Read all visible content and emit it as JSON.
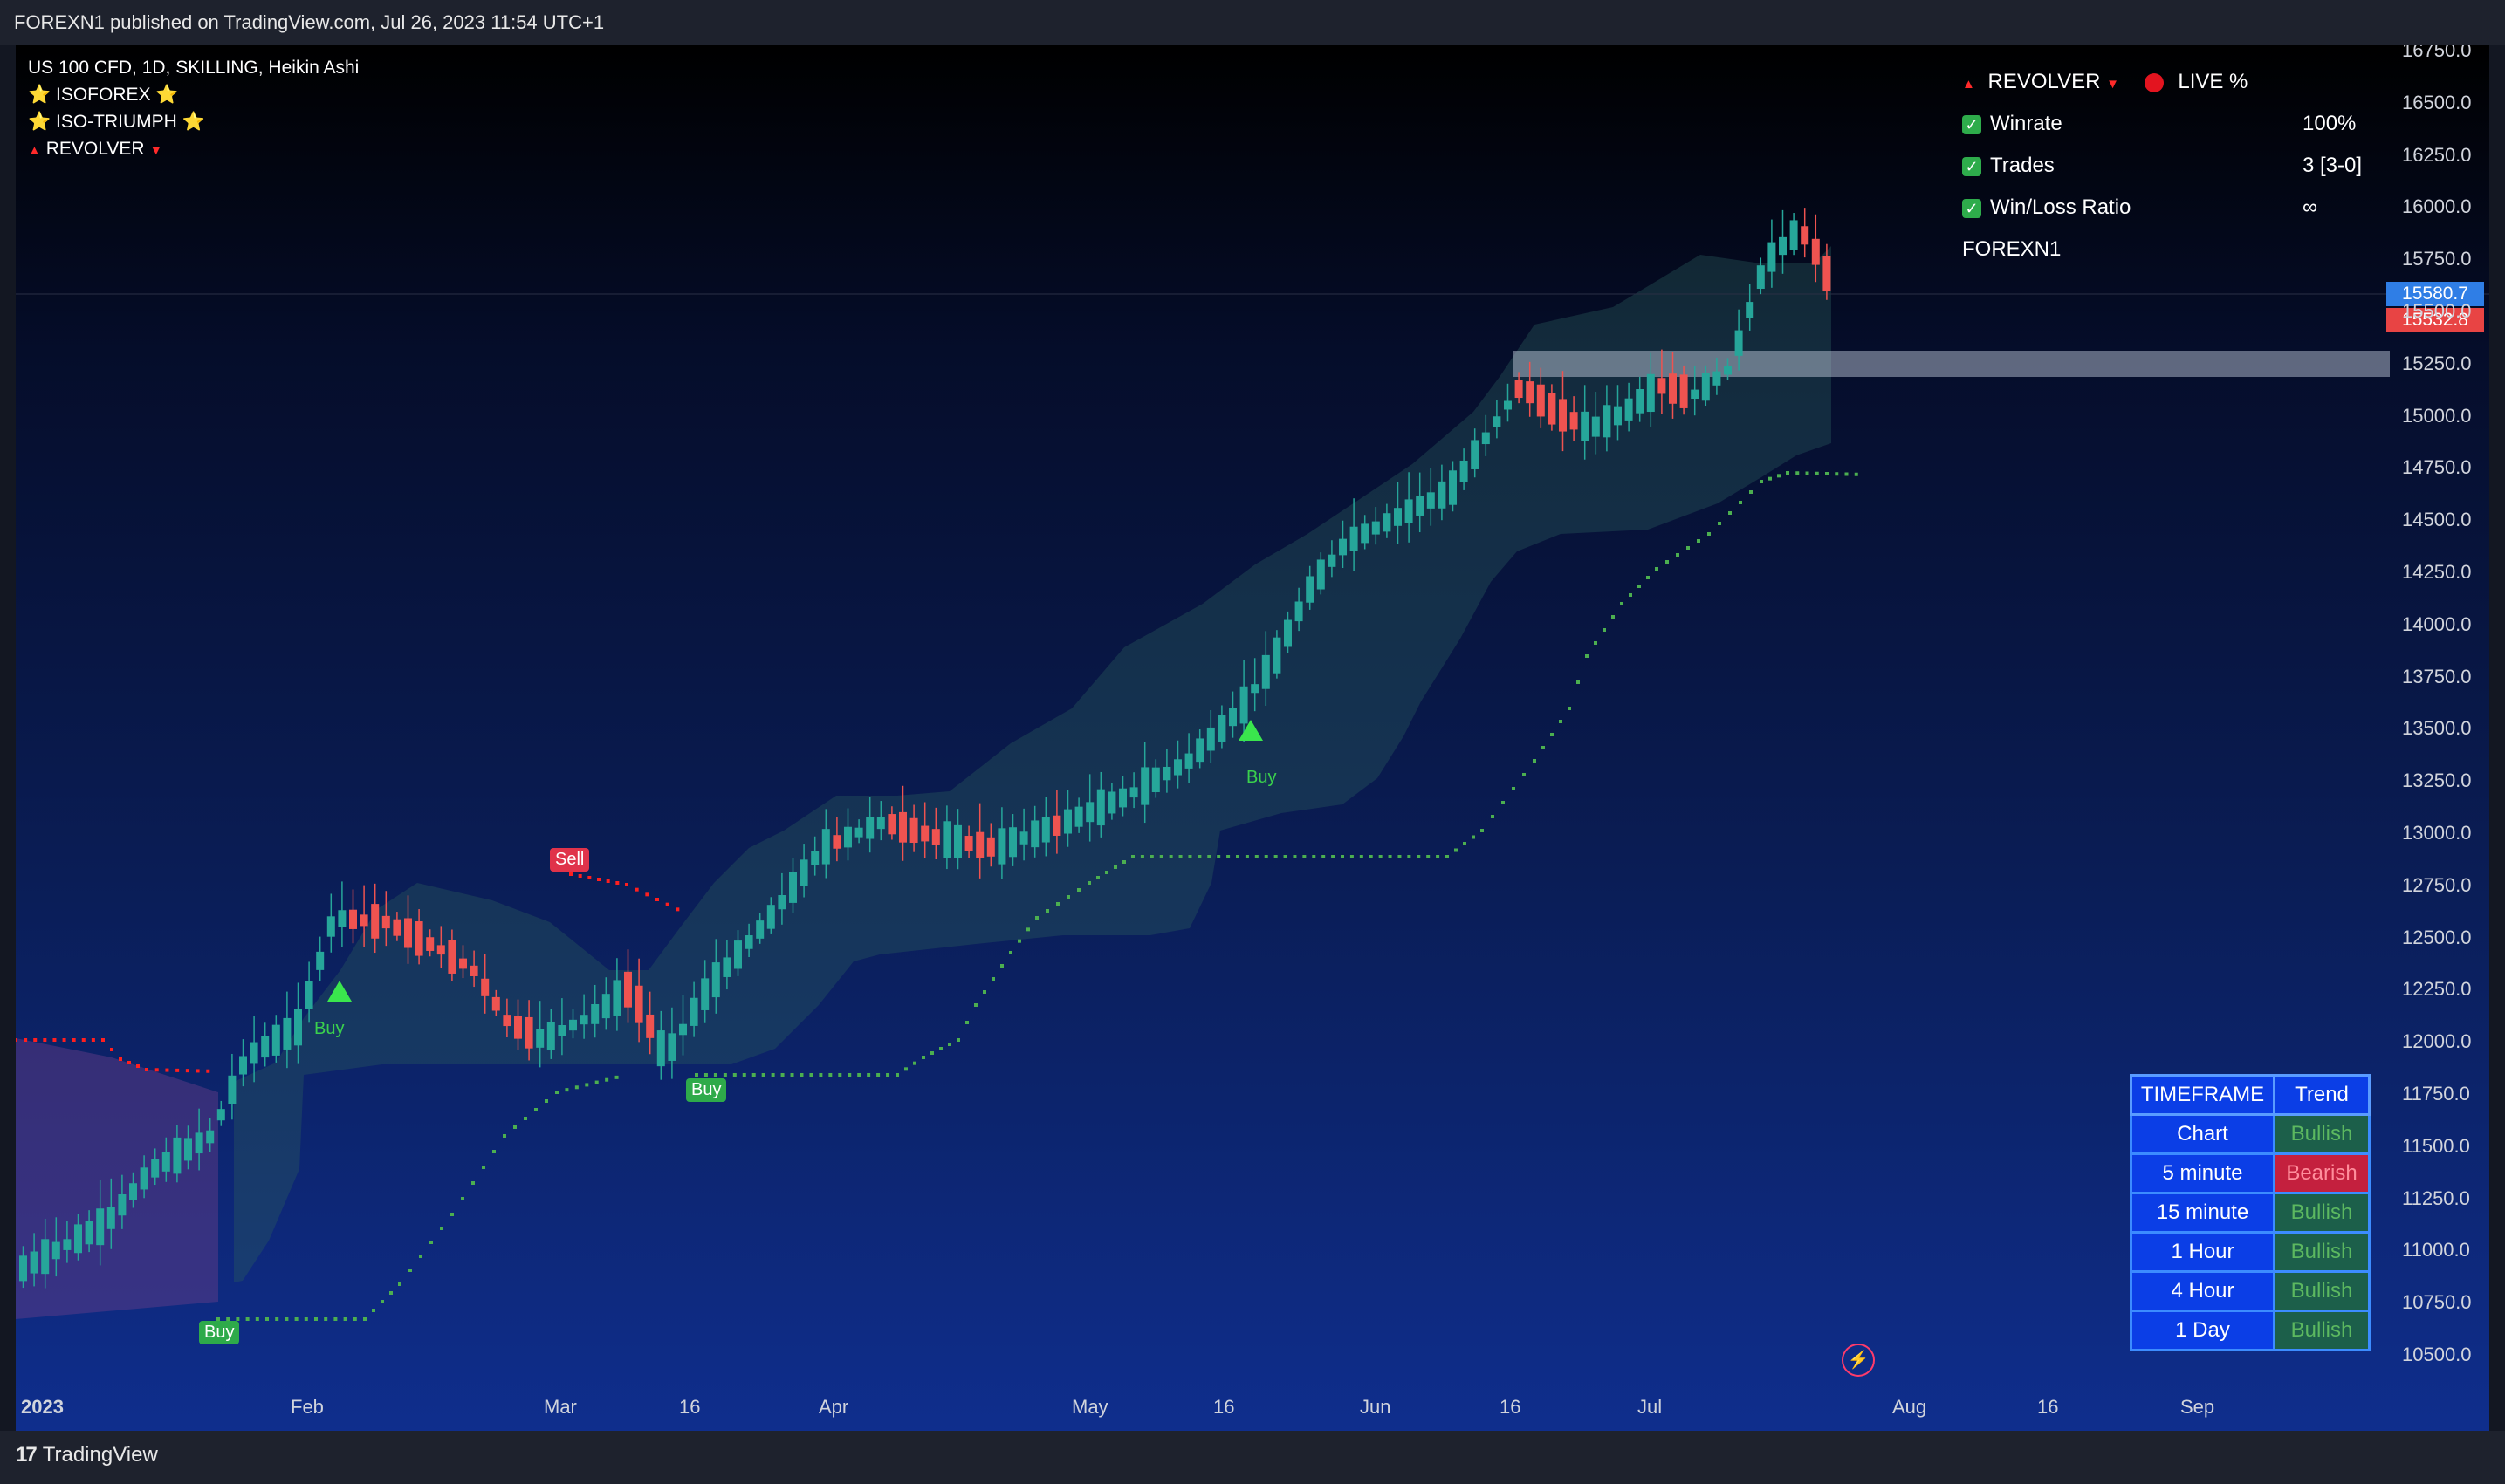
{
  "header": {
    "text": "FOREXN1 published on TradingView.com, Jul 26, 2023 11:54 UTC+1"
  },
  "legend": {
    "symbol": "US 100 CFD, 1D, SKILLING, Heikin Ashi",
    "indicators": [
      {
        "label": "ISOFOREX",
        "icon": "star-icon"
      },
      {
        "label": "ISO-TRIUMPH",
        "icon": "star-icon"
      },
      {
        "label": "REVOLVER",
        "icon": "triangle-icon"
      }
    ]
  },
  "stats": {
    "title": "REVOLVER",
    "live_label": "LIVE %",
    "rows": [
      {
        "label": "Winrate",
        "value": "100%"
      },
      {
        "label": "Trades",
        "value": "3 [3-0]"
      },
      {
        "label": "Win/Loss Ratio",
        "value": "∞"
      }
    ],
    "author": "FOREXN1"
  },
  "timeframe_table": {
    "headers": [
      "TIMEFRAME",
      "Trend"
    ],
    "rows": [
      {
        "timeframe": "Chart",
        "trend": "Bullish"
      },
      {
        "timeframe": "5 minute",
        "trend": "Bearish"
      },
      {
        "timeframe": "15 minute",
        "trend": "Bullish"
      },
      {
        "timeframe": "1 Hour",
        "trend": "Bullish"
      },
      {
        "timeframe": "4 Hour",
        "trend": "Bullish"
      },
      {
        "timeframe": "1 Day",
        "trend": "Bullish"
      }
    ]
  },
  "signals": {
    "buy_box_1": "Buy",
    "buy_box_2": "Buy",
    "sell_box": "Sell",
    "buy_text_1": "Buy",
    "buy_text_2": "Buy"
  },
  "price_tags": {
    "current": "15580.7",
    "secondary": "15532.8"
  },
  "footer": {
    "brand": "TradingView"
  },
  "chart_data": {
    "type": "candlestick",
    "y_ticks": [
      16750,
      16500,
      16250,
      16000,
      15750,
      15500,
      15250,
      15000,
      14750,
      14500,
      14250,
      14000,
      13750,
      13500,
      13250,
      13000,
      12750,
      12500,
      12250,
      12000,
      11750,
      11500,
      11250,
      11000,
      10750,
      10500
    ],
    "x_ticks": [
      "2023",
      "Feb",
      "Mar",
      "16",
      "Apr",
      "May",
      "16",
      "Jun",
      "16",
      "Jul",
      "Aug",
      "16",
      "Sep"
    ],
    "colors": {
      "bull": "#26a69a",
      "bear": "#ef5350",
      "trail_bull": "#4caf50",
      "trail_bear": "#ff1f1f"
    },
    "last_price": 15580.7,
    "resistance_zone": [
      15180,
      15300
    ]
  }
}
